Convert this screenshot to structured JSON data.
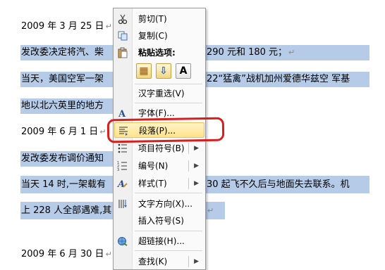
{
  "document": {
    "lines": [
      {
        "text": "2009 年 3 月 25 日"
      },
      {
        "text": "发改委决定将汽、柴",
        "tail": "290 元和 180 元；"
      },
      {
        "text": "当天，美国空军一架",
        "tail": "22“猛禽”战机加州爱德华兹空 军基"
      },
      {
        "text": "地以北六英里的地方"
      },
      {
        "text": "2009 年 6 月 1 日"
      },
      {
        "text": "发改委发布调价通知"
      },
      {
        "text": "当天 14 时,一架载有",
        "tail": "30 起飞不久后与地面失去联系。机"
      },
      {
        "text": "上 228 人全部遇难,其"
      },
      {
        "text": "2009 年 6 月 30 日"
      }
    ],
    "para_mark": "↵"
  },
  "context_menu": {
    "items": [
      {
        "label": "剪切(T)",
        "icon": "scissors-icon"
      },
      {
        "label": "复制(C)",
        "icon": "copy-icon"
      },
      {
        "label": "粘贴选项:",
        "icon": "clipboard-icon"
      },
      {
        "label": "汉字重选(V)"
      },
      {
        "label": "字体(F)...",
        "icon": "font-icon"
      },
      {
        "label": "段落(P)...",
        "icon": "paragraph-icon"
      },
      {
        "label": "项目符号(B)",
        "icon": "bullets-icon",
        "submenu": true
      },
      {
        "label": "编号(N)",
        "icon": "numbering-icon",
        "submenu": true
      },
      {
        "label": "样式(T)",
        "icon": "styles-icon",
        "submenu": true
      },
      {
        "label": "文字方向(X)...",
        "icon": "text-direction-icon"
      },
      {
        "label": "插入符号(S)"
      },
      {
        "label": "超链接(H)...",
        "icon": "hyperlink-icon"
      },
      {
        "label": "查找(K)",
        "submenu": true
      }
    ],
    "paste_buttons": [
      {
        "icon": "keep-source-format-icon",
        "glyph": "▦"
      },
      {
        "icon": "merge-format-icon",
        "glyph": "⇩"
      },
      {
        "icon": "keep-text-only-icon",
        "glyph": "A"
      }
    ],
    "submenu_glyph": "▶"
  },
  "colors": {
    "selection": "#b6cbe8",
    "hover": "#ffe38a",
    "annotation": "#d81f1f"
  }
}
